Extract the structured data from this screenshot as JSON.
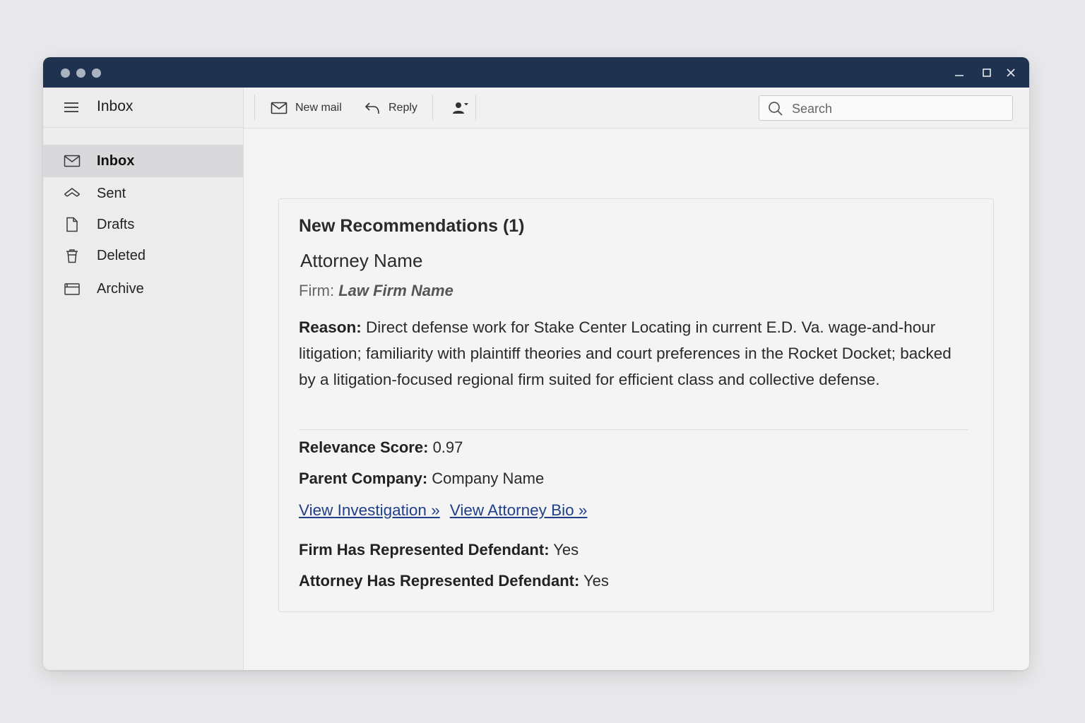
{
  "window": {
    "controls": [
      "minimize-icon",
      "maximize-icon",
      "close-icon"
    ]
  },
  "sidebar": {
    "title": "Inbox",
    "items": [
      {
        "label": "Inbox",
        "icon": "envelope-icon",
        "active": true
      },
      {
        "label": "Sent",
        "icon": "sent-icon",
        "active": false
      },
      {
        "label": "Drafts",
        "icon": "document-icon",
        "active": false
      },
      {
        "label": "Deleted",
        "icon": "trash-icon",
        "active": false
      },
      {
        "label": "Archive",
        "icon": "archive-icon",
        "active": false
      }
    ]
  },
  "toolbar": {
    "new_mail_label": "New mail",
    "reply_label": "Reply",
    "search_placeholder": "Search"
  },
  "recommendation": {
    "heading": "New Recommendations (1)",
    "attorney_name": "Attorney Name",
    "firm_label": "Firm:",
    "firm_name": "Law Firm Name",
    "reason_label": "Reason:",
    "reason_text": "Direct defense work for Stake Center Locating in current E.D. Va. wage-and-hour litigation; familiarity with plaintiff theories and court preferences in the Rocket Docket; backed by a litigation-focused regional firm suited for efficient class and collective defense.",
    "relevance_label": "Relevance Score:",
    "relevance_value": "0.97",
    "parent_label": "Parent Company:",
    "parent_value": "Company Name",
    "link_investigation": "View Investigation »",
    "link_bio": "View Attorney Bio »",
    "firm_rep_label": "Firm Has Represented Defendant:",
    "firm_rep_value": "Yes",
    "atty_rep_label": "Attorney Has Represented Defendant:",
    "atty_rep_value": "Yes"
  },
  "colors": {
    "titlebar": "#1f3250",
    "link": "#1f3f88",
    "active_nav": "#d9d9db"
  }
}
